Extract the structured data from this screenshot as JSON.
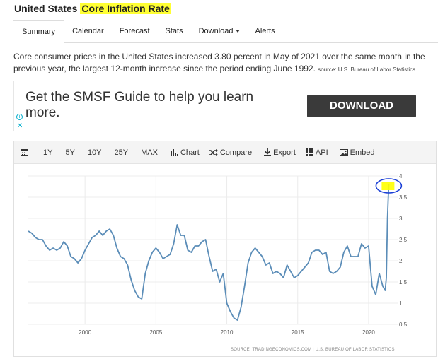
{
  "header": {
    "country": "United States",
    "indicator": "Core Inflation Rate"
  },
  "tabs": [
    {
      "label": "Summary",
      "active": true
    },
    {
      "label": "Calendar"
    },
    {
      "label": "Forecast"
    },
    {
      "label": "Stats"
    },
    {
      "label": "Download"
    },
    {
      "label": "Alerts"
    }
  ],
  "description": {
    "text": "Core consumer prices in the United States increased 3.80 percent in May of 2021 over the same month in the previous year, the largest 12-month increase since the period ending June 1992.",
    "source": "source: U.S. Bureau of Labor Statistics"
  },
  "ad": {
    "text": "Get the SMSF Guide to help you learn more.",
    "button": "DOWNLOAD",
    "info_glyph": "i",
    "close_glyph": "✕"
  },
  "toolbar": {
    "ranges": [
      "1Y",
      "5Y",
      "10Y",
      "25Y",
      "MAX"
    ],
    "chart": "Chart",
    "compare": "Compare",
    "export": "Export",
    "api": "API",
    "embed": "Embed"
  },
  "colors": {
    "line": "#5b8db8",
    "highlight": "#ffff00",
    "circle": "#1a3fd6"
  },
  "chart_data": {
    "type": "line",
    "title": "",
    "xlabel": "",
    "ylabel": "",
    "xlim": [
      1996.0,
      2021.75
    ],
    "ylim": [
      0.5,
      4
    ],
    "x_ticks": [
      2000,
      2005,
      2010,
      2015,
      2020
    ],
    "y_ticks": [
      0.5,
      1,
      1.5,
      2,
      2.5,
      3,
      3.5,
      4
    ],
    "grid": true,
    "source_text": "SOURCE: TRADINGECONOMICS.COM | U.S. BUREAU OF LABOR STATISTICS",
    "series": [
      {
        "x": [
          1996.0,
          1996.25,
          1996.5,
          1996.75,
          1997.0,
          1997.25,
          1997.5,
          1997.75,
          1998.0,
          1998.25,
          1998.5,
          1998.75,
          1999.0,
          1999.25,
          1999.5,
          1999.75,
          2000.0,
          2000.25,
          2000.5,
          2000.75,
          2001.0,
          2001.25,
          2001.5,
          2001.75,
          2002.0,
          2002.25,
          2002.5,
          2002.75,
          2003.0,
          2003.25,
          2003.5,
          2003.75,
          2004.0,
          2004.25,
          2004.5,
          2004.75,
          2005.0,
          2005.25,
          2005.5,
          2005.75,
          2006.0,
          2006.25,
          2006.5,
          2006.75,
          2007.0,
          2007.25,
          2007.5,
          2007.75,
          2008.0,
          2008.25,
          2008.5,
          2008.75,
          2009.0,
          2009.25,
          2009.5,
          2009.75,
          2010.0,
          2010.25,
          2010.5,
          2010.75,
          2011.0,
          2011.25,
          2011.5,
          2011.75,
          2012.0,
          2012.25,
          2012.5,
          2012.75,
          2013.0,
          2013.25,
          2013.5,
          2013.75,
          2014.0,
          2014.25,
          2014.5,
          2014.75,
          2015.0,
          2015.25,
          2015.5,
          2015.75,
          2016.0,
          2016.25,
          2016.5,
          2016.75,
          2017.0,
          2017.25,
          2017.5,
          2017.75,
          2018.0,
          2018.25,
          2018.5,
          2018.75,
          2019.0,
          2019.25,
          2019.5,
          2019.75,
          2020.0,
          2020.25,
          2020.5,
          2020.75,
          2021.0,
          2021.17,
          2021.25,
          2021.33,
          2021.42
        ],
        "values": [
          2.7,
          2.65,
          2.55,
          2.5,
          2.5,
          2.35,
          2.25,
          2.3,
          2.25,
          2.3,
          2.45,
          2.35,
          2.1,
          2.05,
          1.95,
          2.05,
          2.25,
          2.4,
          2.55,
          2.6,
          2.7,
          2.6,
          2.7,
          2.75,
          2.6,
          2.3,
          2.1,
          2.05,
          1.9,
          1.55,
          1.3,
          1.15,
          1.1,
          1.7,
          2.0,
          2.2,
          2.3,
          2.2,
          2.05,
          2.1,
          2.15,
          2.4,
          2.85,
          2.6,
          2.6,
          2.25,
          2.2,
          2.35,
          2.35,
          2.45,
          2.5,
          2.1,
          1.75,
          1.8,
          1.5,
          1.7,
          1.0,
          0.8,
          0.65,
          0.6,
          0.9,
          1.4,
          1.95,
          2.2,
          2.3,
          2.2,
          2.1,
          1.9,
          1.95,
          1.7,
          1.75,
          1.7,
          1.6,
          1.9,
          1.75,
          1.6,
          1.65,
          1.75,
          1.85,
          1.95,
          2.2,
          2.25,
          2.25,
          2.15,
          2.2,
          1.75,
          1.7,
          1.75,
          1.85,
          2.2,
          2.35,
          2.1,
          2.1,
          2.1,
          2.4,
          2.3,
          2.35,
          1.4,
          1.2,
          1.7,
          1.4,
          1.3,
          1.6,
          3.0,
          3.8
        ]
      }
    ]
  }
}
